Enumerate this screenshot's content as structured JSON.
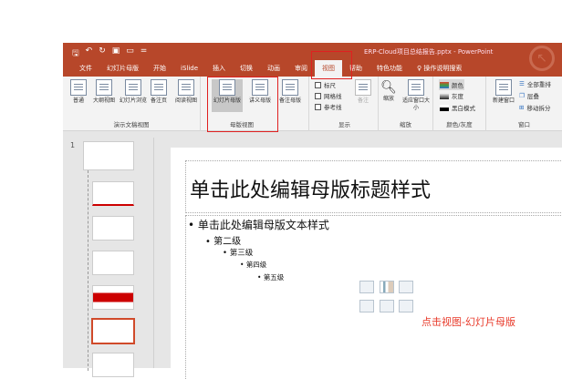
{
  "window": {
    "title": "ERP-Cloud项目总结报告.pptx  -  PowerPoint",
    "qat": [
      "save-icon",
      "undo-icon",
      "redo-icon",
      "present-icon",
      "layout-icon",
      "customize-icon"
    ]
  },
  "tabs": [
    "文件",
    "幻灯片母版",
    "开始",
    "iSlide",
    "插入",
    "切换",
    "动画",
    "审阅",
    "视图",
    "帮助",
    "特色功能",
    "操作说明搜索"
  ],
  "active_tab": "视图",
  "ribbon": {
    "presentation_views": {
      "label": "演示文稿视图",
      "buttons": [
        "普通",
        "大纲视图",
        "幻灯片浏览",
        "备注页",
        "阅读视图"
      ]
    },
    "master_views": {
      "label": "母版视图",
      "buttons": [
        "幻灯片母版",
        "讲义母版",
        "备注母版"
      ],
      "selected": "幻灯片母版"
    },
    "show": {
      "label": "显示",
      "checkboxes": [
        "标尺",
        "网格线",
        "参考线"
      ],
      "notes": "备注"
    },
    "zoom": {
      "label": "缩放",
      "buttons": [
        "缩放",
        "适应窗口大小"
      ]
    },
    "color": {
      "label": "颜色/灰度",
      "items": [
        "颜色",
        "灰度",
        "黑白模式"
      ]
    },
    "window_group": {
      "label": "窗口",
      "new_window": "新建窗口",
      "items": [
        "全部重排",
        "层叠",
        "移动拆分"
      ]
    }
  },
  "slide_pane": {
    "master_number": "1"
  },
  "slide": {
    "title": "单击此处编辑母版标题样式",
    "levels": [
      "单击此处编辑母版文本样式",
      "第二级",
      "第三级",
      "第四级",
      "第五级"
    ],
    "annotation": "点击视图-幻灯片母版"
  },
  "colors": {
    "brand": "#b7472a",
    "highlight": "#e02020",
    "annotation": "#e83a2a"
  }
}
